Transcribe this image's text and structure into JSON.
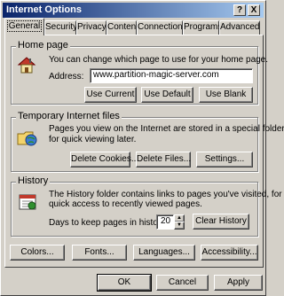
{
  "window": {
    "title": "Internet Options",
    "help_glyph": "?",
    "close_glyph": "X"
  },
  "tabs": [
    {
      "label": "General",
      "active": true
    },
    {
      "label": "Security",
      "active": false
    },
    {
      "label": "Privacy",
      "active": false
    },
    {
      "label": "Content",
      "active": false
    },
    {
      "label": "Connections",
      "active": false
    },
    {
      "label": "Programs",
      "active": false
    },
    {
      "label": "Advanced",
      "active": false
    }
  ],
  "home_page": {
    "legend": "Home page",
    "description": "You can change which page to use for your home page.",
    "address_label": "Address:",
    "address_value": "www.partition-magic-server.com",
    "use_current": "Use Current",
    "use_default": "Use Default",
    "use_blank": "Use Blank",
    "icon": "house-icon"
  },
  "temp_files": {
    "legend": "Temporary Internet files",
    "description_line1": "Pages you view on the Internet are stored in a special folder",
    "description_line2": "for quick viewing later.",
    "delete_cookies": "Delete Cookies...",
    "delete_files": "Delete Files...",
    "settings": "Settings...",
    "icon": "folder-globe-icon"
  },
  "history": {
    "legend": "History",
    "description_line1": "The History folder contains links to pages you've visited, for",
    "description_line2": "quick access to recently viewed pages.",
    "days_label": "Days to keep pages in history:",
    "days_value": "20",
    "clear_history": "Clear History",
    "icon": "history-calendar-icon"
  },
  "bottom_row": {
    "colors": "Colors...",
    "fonts": "Fonts...",
    "languages": "Languages...",
    "accessibility": "Accessibility..."
  },
  "dialog_buttons": {
    "ok": "OK",
    "cancel": "Cancel",
    "apply": "Apply"
  }
}
